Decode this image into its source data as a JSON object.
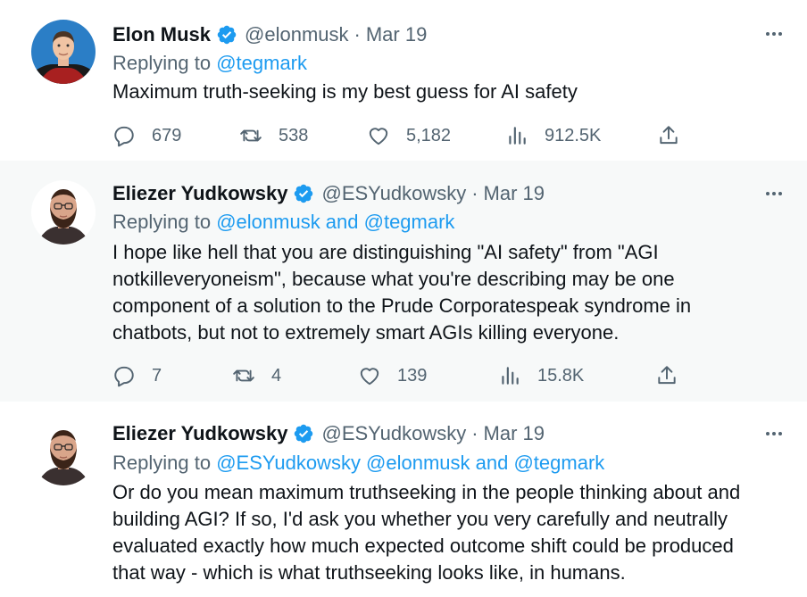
{
  "tweets": [
    {
      "name": "Elon Musk",
      "handle": "@elonmusk",
      "separator": "·",
      "date": "Mar 19",
      "replying_prefix": "Replying to",
      "replying_links": "@tegmark",
      "body": [
        "Maximum truth-seeking is my best guess for AI safety"
      ],
      "stats": {
        "replies": "679",
        "retweets": "538",
        "likes": "5,182",
        "views": "912.5K"
      }
    },
    {
      "name": "Eliezer Yudkowsky",
      "handle": "@ESYudkowsky",
      "separator": "·",
      "date": "Mar 19",
      "replying_prefix": "Replying to",
      "replying_links": "@elonmusk and @tegmark",
      "body": [
        "I hope like hell that you are distinguishing \"AI safety\" from \"AGI",
        "notkilleveryoneism\", because what you're describing may be one",
        "component of a solution to the Prude Corporatespeak syndrome in",
        "chatbots, but not to extremely smart AGIs killing everyone."
      ],
      "stats": {
        "replies": "7",
        "retweets": "4",
        "likes": "139",
        "views": "15.8K"
      }
    },
    {
      "name": "Eliezer Yudkowsky",
      "handle": "@ESYudkowsky",
      "separator": "·",
      "date": "Mar 19",
      "replying_prefix": "Replying to",
      "replying_links": "@ESYudkowsky @elonmusk and @tegmark",
      "body": [
        "Or do you mean maximum truthseeking in the people thinking about and",
        "building AGI?  If so, I'd ask you whether you very carefully and neutrally",
        "evaluated exactly how much expected outcome shift could be produced",
        "that way - which is what truthseeking looks like, in humans."
      ]
    }
  ],
  "colors": {
    "link": "#1d9bf0",
    "secondary_text": "#536471",
    "verified_badge": "#1d9bf0",
    "thread_line": "#cfd9de",
    "highlight_bg": "#f7f9f9"
  },
  "icons": [
    "verified-badge-icon",
    "more-icon",
    "reply-icon",
    "retweet-icon",
    "like-icon",
    "views-icon",
    "share-icon"
  ]
}
